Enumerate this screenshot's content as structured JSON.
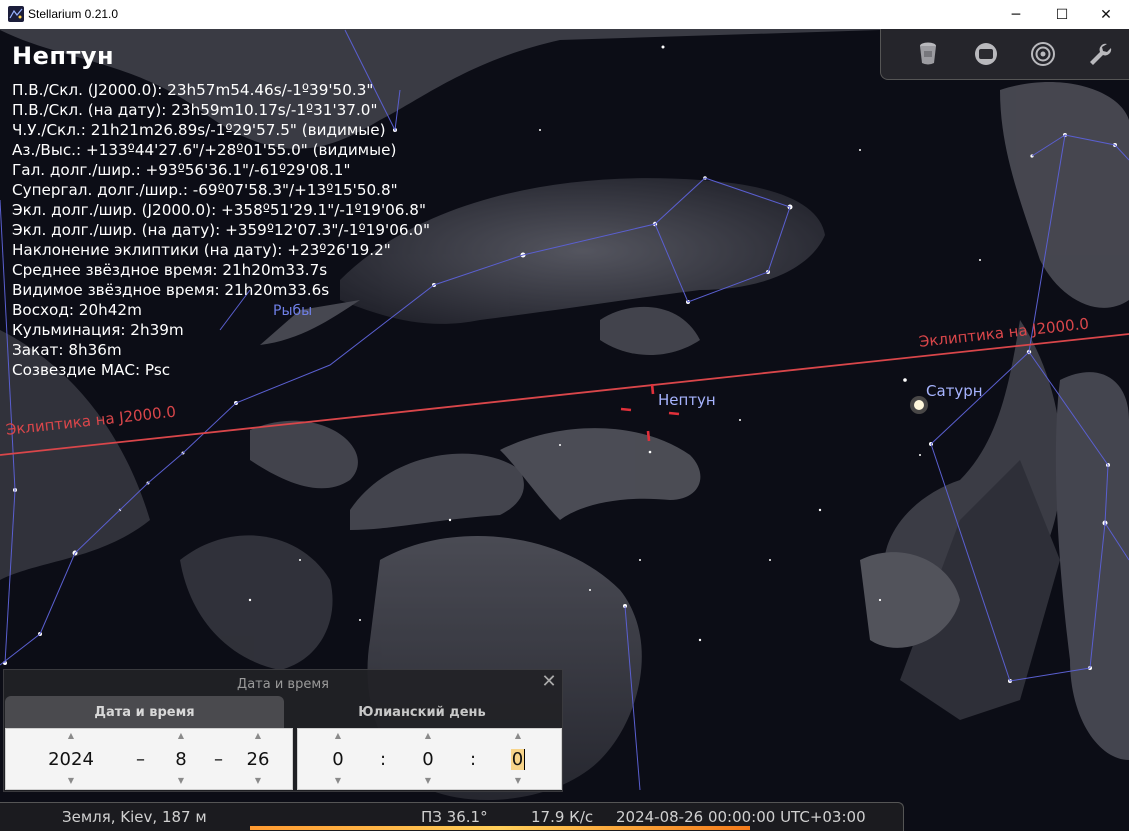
{
  "window": {
    "title": "Stellarium 0.21.0",
    "minimize_glyph": "─",
    "maximize_glyph": "☐",
    "close_glyph": "✕"
  },
  "object_info": {
    "name": "Нептун",
    "lines": [
      "П.В./Скл. (J2000.0): 23h57m54.46s/-1º39'50.3\"",
      "П.В./Скл. (на дату): 23h59m10.17s/-1º31'37.0\"",
      "Ч.У./Скл.: 21h21m26.89s/-1º29'57.5\" (видимые)",
      "Аз./Выс.: +133º44'27.6\"/+28º01'55.0\" (видимые)",
      "Гал. долг./шир.: +93º56'36.1\"/-61º29'08.1\"",
      "Супергал. долг./шир.: -69º07'58.3\"/+13º15'50.8\"",
      "Экл. долг./шир. (J2000.0): +358º51'29.1\"/-1º19'06.8\"",
      "Экл. долг./шир. (на дату): +359º12'07.3\"/-1º19'06.0\"",
      "Наклонение эклиптики (на дату): +23º26'19.2\"",
      "Среднее звёздное время: 21h20m33.7s",
      "Видимое звёздное время: 21h20m33.6s",
      "Восход: 20h42m",
      "Кульминация: 2h39m",
      "Закат: 8h36m",
      "Созвездие МАС: Psc"
    ]
  },
  "sky_labels": {
    "constellation": "Рыбы",
    "ecliptic_left": "Эклиптика на J2000.0",
    "ecliptic_right": "Эклиптика на J2000.0",
    "neptune": "Нептун",
    "saturn": "Сатурн"
  },
  "toolbar": {
    "buttons": [
      "telescope-icon",
      "screen-icon",
      "target-icon",
      "wrench-icon"
    ]
  },
  "datetime_dialog": {
    "title": "Дата и время",
    "close_glyph": "✕",
    "tabs": [
      "Дата и время",
      "Юлианский день"
    ],
    "active_tab": 0,
    "date": {
      "year": "2024",
      "month": "8",
      "day": "26",
      "separator": "–"
    },
    "time": {
      "hour": "0",
      "minute": "0",
      "second": "0",
      "separator": ":"
    }
  },
  "statusbar": {
    "location": "Земля, Kiev, 187 м",
    "fov": "ПЗ 36.1°",
    "fps": "17.9 К/с",
    "datetime": "2024-08-26 00:00:00 UTC+03:00"
  },
  "colors": {
    "ecliptic": "#d9464a",
    "constellation_lines": "#5a5fd0",
    "constellation_label": "#6f7fe6",
    "planet_label": "#a7b4ff",
    "marker": "#e0303a"
  }
}
